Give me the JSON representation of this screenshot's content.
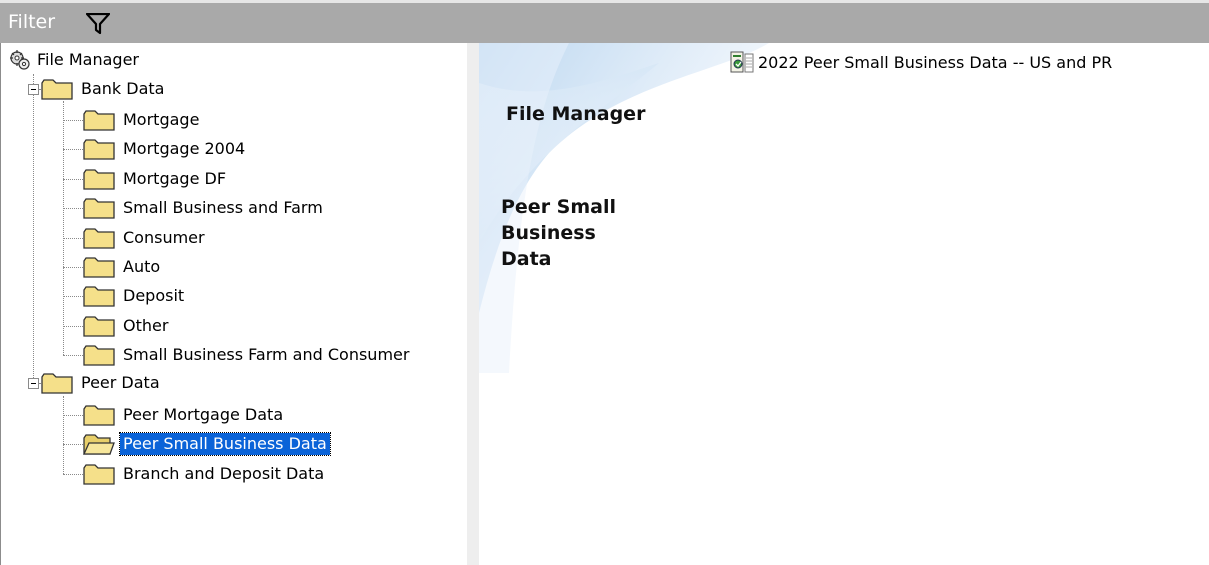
{
  "filter": {
    "label": "Filter",
    "icon": "funnel-icon"
  },
  "tree": {
    "root": {
      "label": "File Manager",
      "icon": "file-manager-gears-icon"
    },
    "groups": [
      {
        "label": "Bank Data",
        "expanded": true,
        "items": [
          {
            "label": "Mortgage"
          },
          {
            "label": "Mortgage 2004"
          },
          {
            "label": "Mortgage DF"
          },
          {
            "label": "Small Business and Farm"
          },
          {
            "label": "Consumer"
          },
          {
            "label": "Auto"
          },
          {
            "label": "Deposit"
          },
          {
            "label": "Other"
          },
          {
            "label": "Small Business Farm and Consumer"
          }
        ]
      },
      {
        "label": "Peer Data",
        "expanded": true,
        "items": [
          {
            "label": "Peer Mortgage Data"
          },
          {
            "label": "Peer Small Business Data",
            "selected": true
          },
          {
            "label": "Branch and Deposit Data"
          }
        ]
      }
    ]
  },
  "content": {
    "title": "File Manager",
    "section": "Peer Small Business Data",
    "reports": [
      {
        "label": "2022 Peer Small Business Data -- US and PR",
        "icon": "report-file-icon"
      }
    ]
  },
  "colors": {
    "filter_bar": "#a9a9a9",
    "selection": "#0a63d8",
    "folder": "#f5e08a",
    "content_swoosh": "#cfe3f5"
  }
}
